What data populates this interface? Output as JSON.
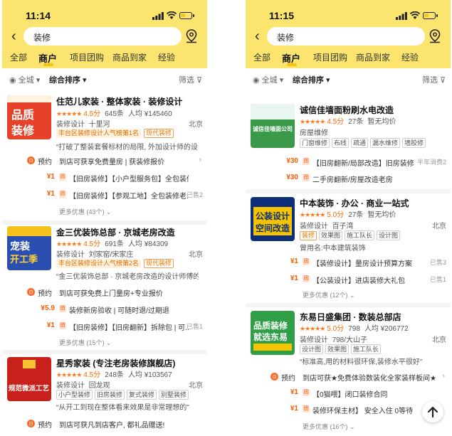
{
  "left": {
    "time": "11:14",
    "search_value": "装修",
    "tabs": [
      "全部",
      "商户",
      "项目团购",
      "商品到家",
      "经验"
    ],
    "filter": {
      "area": "全城",
      "sort": "综合排序",
      "screen": "筛选"
    },
    "cards": [
      {
        "thumb_text": [
          "品质",
          "装修"
        ],
        "name": "住范儿家装 · 整体家装 · 装修设计",
        "score": "4.5分",
        "reviews": "645条",
        "avg": "人均 ¥145460",
        "category": "装修设计",
        "district": "十里河",
        "city": "北京",
        "badge": "丰台区装修设计人气榜第1名",
        "badge_tag": "现代装修",
        "quote": "“打破了整装套餐标材的局限, 外加设计师的设...",
        "booking_label": "预约",
        "booking_text": "到店可获享免费量房 | 获装修报价",
        "deals": [
          {
            "price": "¥1",
            "text": "【旧房装修】【小户型服务包】全包装修老...",
            "sold": ""
          },
          {
            "price": "¥1",
            "text": "【旧房装修】【参观工地】全包装修老...",
            "sold": "已售2"
          }
        ],
        "more": "更多优惠 (43个)"
      },
      {
        "thumb_text": [
          "宠装",
          "开工季"
        ],
        "name": "金三优装饰总部 · 京城老房改造",
        "score": "4.5分",
        "reviews": "691条",
        "avg": "人均 ¥84309",
        "category": "装修设计",
        "district": "刘家窑/宋家庄",
        "city": "北京",
        "badge": "丰台区装修设计人气榜第2名",
        "badge_tag": "现代装修",
        "quote": "“金三优装饰总部 · 京城老房改造的设计师傅的很...",
        "booking_label": "预约",
        "booking_text": "到店可获免费上门量房+专业报价",
        "deals": [
          {
            "price": "¥5.9",
            "text": "装修新房验收 | 可随时退/过期退",
            "sold": ""
          },
          {
            "price": "¥1",
            "text": "【旧房装修】【旧房翻新】拆除包 | 可...",
            "sold": "已售1"
          }
        ],
        "more": "更多优惠 (15个)"
      },
      {
        "thumb_text": [
          "规范微派工艺"
        ],
        "name": "星秀家装 (专注老房装修旗舰店)",
        "score": "4.5分",
        "reviews": "248条",
        "avg": "人均 ¥103567",
        "category": "装修设计",
        "district": "回龙观",
        "city": "北京",
        "tags": [
          "小户型装修",
          "旧房装修",
          "复式装修",
          "别墅装修"
        ],
        "quote": "“从开工到现在整体看来效果是非常理想的”",
        "booking_label": "预约",
        "booking_text": "到店可获凡到店客户, 都礼品赠送!"
      }
    ]
  },
  "right": {
    "time": "11:15",
    "search_value": "装修",
    "tabs": [
      "全部",
      "商户",
      "项目团购",
      "商品到家",
      "经验"
    ],
    "filter": {
      "area": "全城",
      "sort": "综合排序",
      "screen": "筛选"
    },
    "cards": [
      {
        "thumb_text": [
          "诚信佳墙面公司"
        ],
        "name": "诚信佳墙面粉刷水电改造",
        "score": "4.5分",
        "reviews": "27条",
        "avg": "暂无均价",
        "category": "房屋维修",
        "tags": [
          "门窗维修",
          "布线",
          "疏通",
          "漏水维修",
          "墙胶修"
        ],
        "deals": [
          {
            "price": "¥30",
            "text": "【旧房翻新/局部改造】旧房装修",
            "sold": "半年消费2"
          },
          {
            "price": "¥30",
            "text": "二手房翻新/房屋改造老房",
            "sold": ""
          }
        ]
      },
      {
        "thumb_text": [
          "公装设计",
          "空间改造"
        ],
        "name": "中本装饰 · 办公 · 商业一站式",
        "score": "5.0分",
        "reviews": "27条",
        "avg": "暂无均价",
        "category": "装修设计",
        "district": "百子湾",
        "city": "北京",
        "tags": [
          "装修",
          "效果图",
          "施工队长",
          "设计图"
        ],
        "former": "曾用名:中本建筑装饰",
        "deals": [
          {
            "price": "¥1",
            "text": "【装修设计】量房设计预算方案",
            "sold": "已售3"
          },
          {
            "price": "¥1",
            "text": "【公装设计】进店装修大礼包",
            "sold": "已售1"
          }
        ],
        "more": "更多优惠 (12个)"
      },
      {
        "thumb_text": [
          "品质装修",
          "就选东易"
        ],
        "name": "东易日盛集团 · 数装总部店",
        "score": "5.0分",
        "reviews": "798",
        "avg": "人均 ¥206772",
        "category": "装修设计",
        "district": "798/大山子",
        "city": "北京",
        "tags": [
          "设计图",
          "效果图",
          "施工队长"
        ],
        "quote": "“标准高,用的材料很环保,装修水平很好”",
        "booking_label": "预约",
        "booking_text": "到店可获★免费体验数装化全家装样板间★",
        "deals": [
          {
            "price": "¥1",
            "text": "【0猫喂】闭口装修合同",
            "sold": ""
          },
          {
            "price": "¥1",
            "text": "装修环保主材】 安全入住 0等待",
            "sold": ""
          }
        ],
        "more": "更多优惠 (16个)"
      }
    ]
  }
}
